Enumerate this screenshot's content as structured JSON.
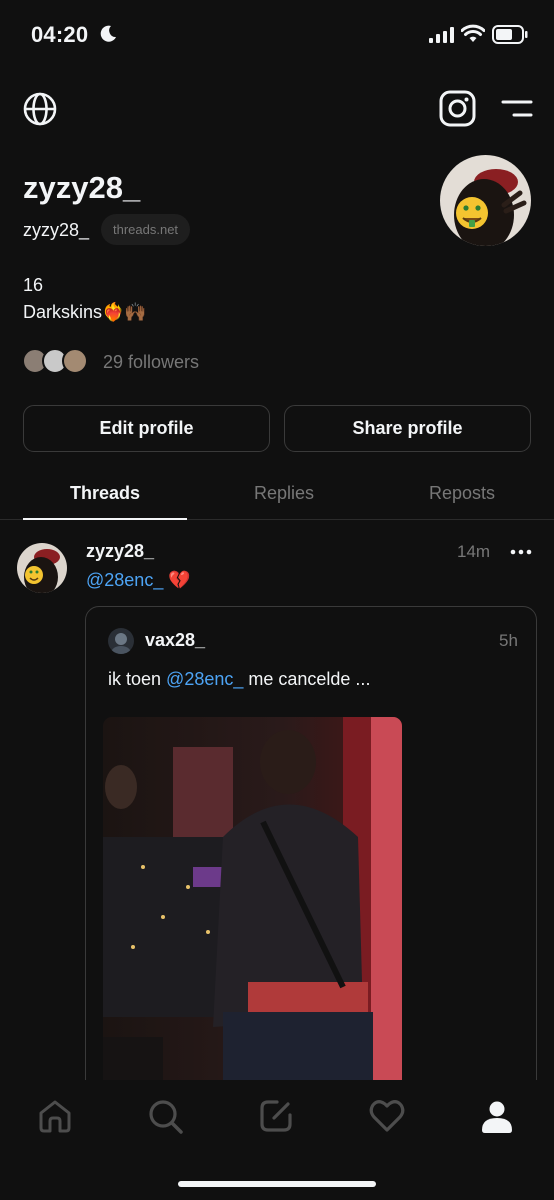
{
  "status_bar": {
    "time": "04:20"
  },
  "profile": {
    "username": "zyzy28_",
    "handle": "zyzy28_",
    "domain": "threads.net",
    "bio_line1": "16",
    "bio_line2": "Darkskins❤️‍🔥🙌🏾",
    "followers": "29 followers",
    "edit_label": "Edit profile",
    "share_label": "Share profile"
  },
  "tabs": [
    "Threads",
    "Replies",
    "Reposts"
  ],
  "post": {
    "user": "zyzy28_",
    "time": "14m",
    "mention": "@28enc_",
    "after_mention": " 💔"
  },
  "quote": {
    "user": "vax28_",
    "time": "5h",
    "text_before": "ik toen ",
    "mention": "@28enc_",
    "text_after": " me cancelde ..."
  },
  "icons": {
    "top": [
      "globe-icon",
      "instagram-icon",
      "menu-icon"
    ],
    "nav": [
      "home-icon",
      "search-icon",
      "compose-icon",
      "heart-icon",
      "profile-icon"
    ]
  },
  "colors": {
    "background": "#101010",
    "text": "#f3f5f7",
    "muted": "#777777",
    "link": "#4da4f5",
    "border": "#3a3a3a"
  }
}
